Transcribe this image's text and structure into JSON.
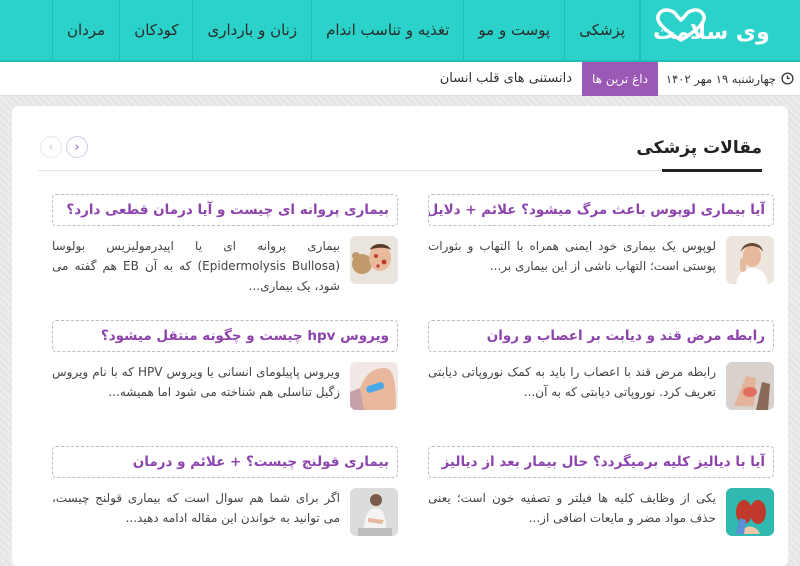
{
  "logo": {
    "text": "وی سلامت"
  },
  "nav": {
    "items": [
      {
        "label": "پزشکی"
      },
      {
        "label": "پوست و مو"
      },
      {
        "label": "تغذیه و تناسب اندام"
      },
      {
        "label": "زنان و بارداری"
      },
      {
        "label": "کودکان"
      },
      {
        "label": "مردان"
      }
    ]
  },
  "subbar": {
    "date": "چهارشنبه ۱۹ مهر ۱۴۰۲",
    "hot_label": "داغ ترین ها",
    "hot_title": "دانستنی های قلب انسان"
  },
  "section": {
    "title": "مقالات پزشکی",
    "next_arrow": "›",
    "prev_arrow": "‹"
  },
  "articles": [
    {
      "title": "آیا بیماری لوپوس باعث مرگ میشود؟ علائم + دلایل",
      "excerpt": "لوپوس یک بیماری خود ایمنی همراه با التهاب و بثورات پوستی است؛ التهاب ناشی از این بیماری بر...",
      "thumb": "woman-touching-face"
    },
    {
      "title": "بیماری پروانه ای چیست و آیا درمان قطعی دارد؟",
      "excerpt": "بیماری پروانه ای یا اپیدرمولیزیس بولوسا (Epidermolysis Bullosa) که به آن EB هم گفته می شود، یک بیماری...",
      "thumb": "child-with-teddy"
    },
    {
      "title": "رابطه مرض قند و دیابت بر اعصاب و روان",
      "excerpt": "رابطه مرض قند با اعصاب را باید به کمک نوروپاتی دیابتی تعریف کرد. نوروپاتی دیابتی که به آن...",
      "thumb": "foot-pain"
    },
    {
      "title": "ویروس hpv چیست و چگونه منتقل میشود؟",
      "excerpt": "ویروس پاپیلومای انسانی یا ویروس HPV که با نام ویروس زگیل تناسلی هم شناخته می شود اما همیشه...",
      "thumb": "arm-bandage"
    },
    {
      "title": "آیا با دیالیز کلیه برمیگردد؟ حال بیمار بعد از دیالیز",
      "excerpt": "یکی از وظایف کلیه ها فیلتر و تصفیه خون است؛ یعنی حذف مواد مضر و مایعات اضافی از...",
      "thumb": "kidney-model"
    },
    {
      "title": "بیماری قولنج چیست؟ + علائم و درمان",
      "excerpt": "اگر برای شما هم سوال است که بیماری قولنج چیست، می توانید به خواندن این مقاله ادامه دهید...",
      "thumb": "person-stomach-pain"
    }
  ],
  "colors": {
    "nav_bg": "#2ad2c9",
    "accent_purple": "#9b59b6",
    "title_purple": "#8e44ad"
  }
}
